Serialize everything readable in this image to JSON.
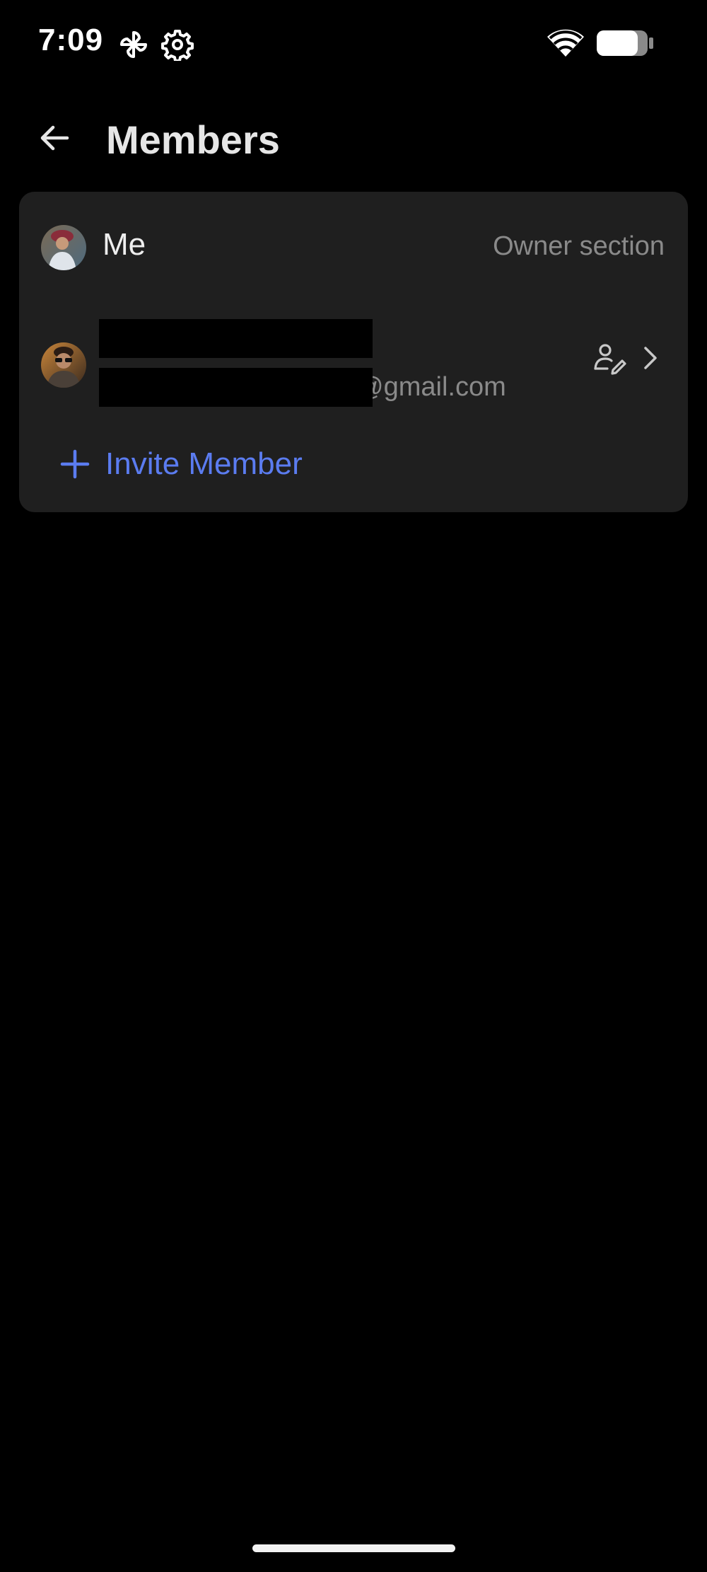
{
  "status_bar": {
    "time": "7:09",
    "icons": [
      "pinwheel-icon",
      "gear-icon",
      "wifi-icon",
      "battery-icon"
    ]
  },
  "header": {
    "back_icon": "arrow-left-icon",
    "title": "Members"
  },
  "members": {
    "me": {
      "label": "Me",
      "role": "Owner section"
    },
    "member": {
      "email_suffix": "@gmail.com",
      "actions": [
        "edit-role-icon",
        "chevron-right-icon"
      ]
    },
    "invite": {
      "label": "Invite Member",
      "icon": "plus-icon"
    }
  },
  "colors": {
    "background": "#000000",
    "card": "#1f1f1f",
    "accent": "#5b7cf0",
    "muted_text": "#8a8a8a"
  }
}
